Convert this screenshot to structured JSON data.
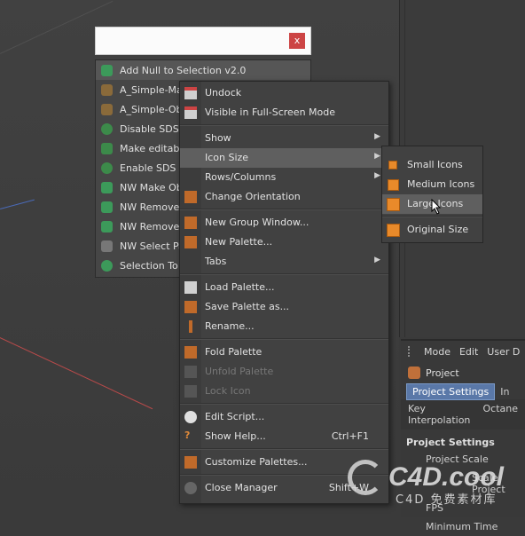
{
  "palette": {
    "items": [
      {
        "label": "Add Null to Selection v2.0",
        "color": "#3c9a5a"
      },
      {
        "label": "A_Simple-Mat",
        "color": "#8a6a3a"
      },
      {
        "label": "A_Simple-Obje",
        "color": "#8a6a3a"
      },
      {
        "label": "Disable SDS",
        "color": "#3c8a4a"
      },
      {
        "label": "Make editable",
        "color": "#3c8a4a"
      },
      {
        "label": "Enable SDS",
        "color": "#3c8a4a"
      },
      {
        "label": "NW Make Obj",
        "color": "#3c9a5a"
      },
      {
        "label": "NW Remove C",
        "color": "#3c9a5a"
      },
      {
        "label": "NW Remove C",
        "color": "#3c9a5a"
      },
      {
        "label": "NW Select Par",
        "color": "#777777"
      },
      {
        "label": "Selection To C",
        "color": "#3c9a5a"
      }
    ]
  },
  "titlebar": {
    "close": "x"
  },
  "context_menu": {
    "undock": "Undock",
    "fullscreen": "Visible in Full-Screen Mode",
    "show": "Show",
    "icon_size": "Icon Size",
    "rows_columns": "Rows/Columns",
    "change_orientation": "Change Orientation",
    "new_group_window": "New Group Window...",
    "new_palette": "New Palette...",
    "tabs": "Tabs",
    "load_palette": "Load Palette...",
    "save_palette": "Save Palette as...",
    "rename": "Rename...",
    "fold_palette": "Fold Palette",
    "unfold_palette": "Unfold Palette",
    "lock_icon": "Lock Icon",
    "edit_script": "Edit Script...",
    "show_help": "Show Help...",
    "show_help_shortcut": "Ctrl+F1",
    "customize": "Customize Palettes...",
    "close_manager": "Close Manager",
    "close_manager_shortcut": "Shift+W"
  },
  "icon_size_submenu": {
    "small": "Small Icons",
    "medium": "Medium Icons",
    "large": "Large Icons",
    "original": "Original Size"
  },
  "attributes": {
    "menu": [
      "Mode",
      "Edit",
      "User D"
    ],
    "title": "Project",
    "tab_active": "Project Settings",
    "tab_other": "In",
    "row2": [
      "Key Interpolation",
      "Octane"
    ],
    "section": "Project Settings",
    "fields": [
      "Project Scale",
      "Scale Project",
      "FPS",
      "Minimum Time"
    ]
  },
  "watermark": {
    "text": "C4D.cool",
    "sub": "C4D 免费素材库"
  },
  "colors": {
    "accent": "#5a78a8",
    "orange": "#e98a2a"
  }
}
